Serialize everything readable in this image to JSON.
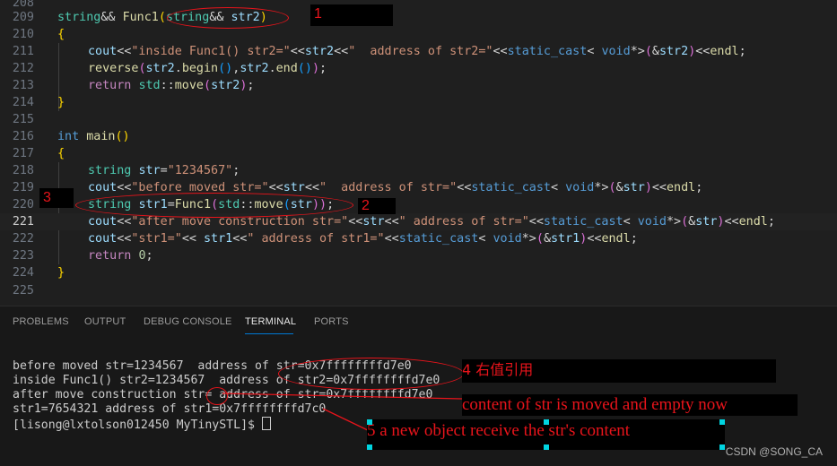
{
  "editor": {
    "line_numbers": [
      "208",
      "209",
      "210",
      "211",
      "212",
      "213",
      "214",
      "215",
      "216",
      "217",
      "218",
      "219",
      "220",
      "221",
      "222",
      "223",
      "224",
      "225"
    ],
    "l209": [
      "string",
      "&&",
      " ",
      "Func1",
      "(",
      "string",
      "&&",
      " ",
      "str2",
      ")"
    ],
    "l210": "{",
    "l211": [
      "cout",
      "<<",
      "\"inside Func1() str2=\"",
      "<<",
      "str2",
      "<<",
      "\"  address of str2=\"",
      "<<",
      "static_cast",
      "< ",
      "void",
      "*>",
      "(",
      "&",
      "str2",
      ")",
      "<<",
      "endl",
      ";"
    ],
    "l212": [
      "reverse",
      "(",
      "str2",
      ".",
      "begin",
      "()",
      ",",
      "str2",
      ".",
      "end",
      "()",
      ")",
      ";"
    ],
    "l213": [
      "return",
      " ",
      "std",
      "::",
      "move",
      "(",
      "str2",
      ")",
      ";"
    ],
    "l214": "}",
    "l216": [
      "int",
      " ",
      "main",
      "()"
    ],
    "l217": "{",
    "l218": [
      "string",
      " ",
      "str",
      "=",
      "\"1234567\"",
      ";"
    ],
    "l219": [
      "cout",
      "<<",
      "\"before moved str=\"",
      "<<",
      "str",
      "<<",
      "\"  address of str=\"",
      "<<",
      "static_cast",
      "< ",
      "void",
      "*>",
      "(",
      "&",
      "str",
      ")",
      "<<",
      "endl",
      ";"
    ],
    "l220": [
      "string",
      " ",
      "str1",
      "=",
      "Func1",
      "(",
      "std",
      "::",
      "move",
      "(",
      "str",
      "))",
      ";"
    ],
    "l221": [
      "cout",
      "<<",
      "\"after move construction str=\"",
      "<<",
      "str",
      "<<",
      "\" address of str=\"",
      "<<",
      "static_cast",
      "< ",
      "void",
      "*>",
      "(",
      "&",
      "str",
      ")",
      "<<",
      "endl",
      ";"
    ],
    "l222": [
      "cout",
      "<<",
      "\"str1=\"",
      "<<",
      " str1",
      "<<",
      "\" address of str1=\"",
      "<<",
      "static_cast",
      "< ",
      "void",
      "*>",
      "(",
      "&",
      "str1",
      ")",
      "<<",
      "endl",
      ";"
    ],
    "l223": [
      "return",
      " ",
      "0",
      ";"
    ],
    "l224": "}"
  },
  "panel": {
    "tabs": [
      "PROBLEMS",
      "OUTPUT",
      "DEBUG CONSOLE",
      "TERMINAL",
      "PORTS"
    ],
    "active_tab": "TERMINAL",
    "terminal_lines": [
      "before moved str=1234567  address of str=0x7ffffffffd7e0",
      "inside Func1() str2=1234567  address of str2=0x7ffffffffd7e0",
      "after move construction str= address of str=0x7ffffffffd7e0",
      "str1=7654321 address of str1=0x7ffffffffd7c0",
      "[lisong@lxtolson012450 MyTinySTL]$ "
    ]
  },
  "annotations": {
    "label1": "1",
    "label2": "2",
    "label3": "3",
    "note4": "4 右值引用",
    "note_content": "content of str is moved and empty now",
    "note5": "5 a new object receive the str's content"
  },
  "watermark": "CSDN @SONG_CA",
  "colors": {
    "annotation": "#e8141b",
    "active_tab_underline": "#0078d4",
    "selection_handles": "#00d4e0"
  }
}
